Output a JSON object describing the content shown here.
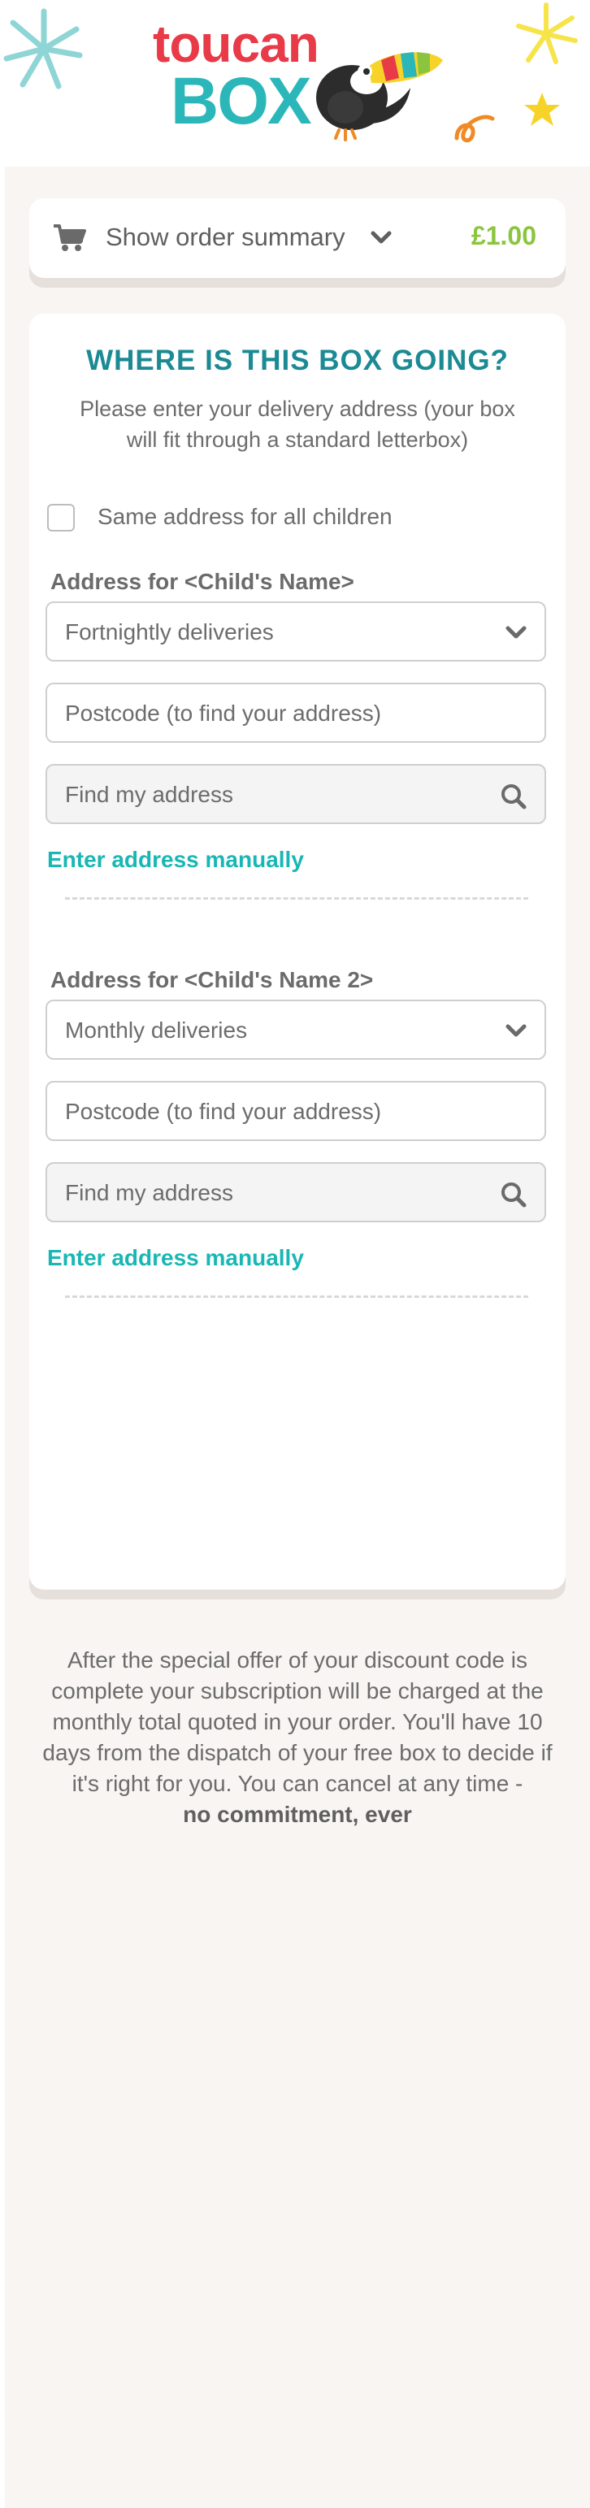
{
  "brand": {
    "logo_word_top": "toucan",
    "logo_word_bottom": "BOX",
    "colors": {
      "primary_red": "#e83a47",
      "teal": "#2bb7b9",
      "title_teal": "#1b8a94",
      "link_teal": "#19b7b4",
      "price_green": "#8bc53f"
    }
  },
  "summary": {
    "icon": "cart-icon",
    "label": "Show order summary",
    "chevron": "chevron-down-icon",
    "price": "£1.00"
  },
  "form": {
    "title": "WHERE IS THIS BOX GOING?",
    "subtitle": "Please enter your delivery address (your box will fit through a standard letterbox)",
    "same_address_label": "Same address for all children",
    "children": [
      {
        "address_label": "Address for <Child's Name>",
        "frequency": "Fortnightly deliveries",
        "postcode_placeholder": "Postcode (to find your address)",
        "find_address": "Find my address",
        "manual_link": "Enter address manually"
      },
      {
        "address_label": "Address for <Child's Name 2>",
        "frequency": "Monthly deliveries",
        "postcode_placeholder": "Postcode (to find your address)",
        "find_address": "Find my address",
        "manual_link": "Enter address manually"
      }
    ]
  },
  "footer": {
    "text": "After the special offer of your discount code is complete your subscription will be charged at the monthly total quoted in your order. You'll have 10 days from the dispatch of your free box to decide if it's right for you. You can cancel at any time -",
    "emphasis": "no commitment, ever"
  }
}
